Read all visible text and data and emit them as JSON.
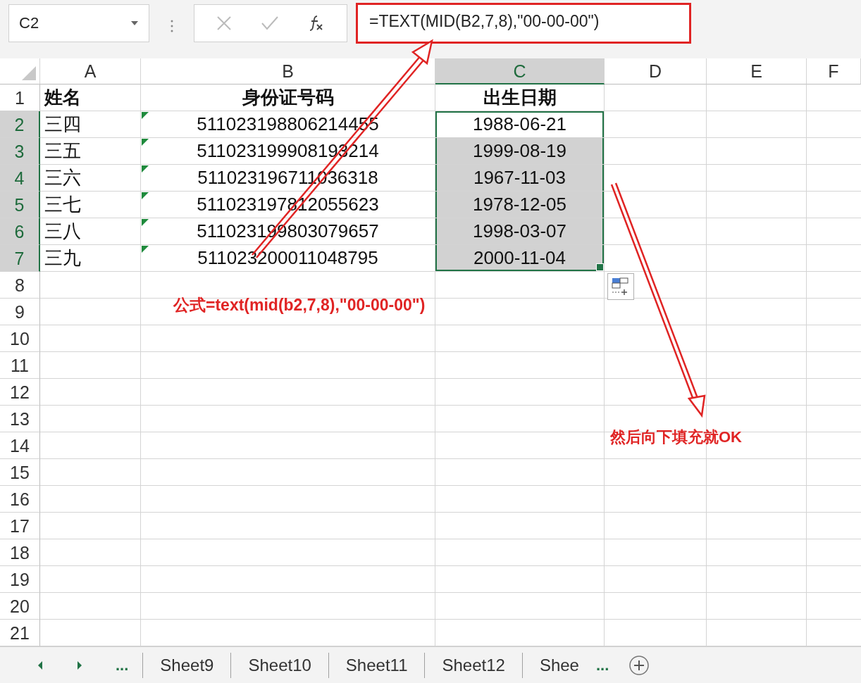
{
  "name_box": {
    "value": "C2"
  },
  "formula_bar": {
    "formula": "=TEXT(MID(B2,7,8),\"00-00-00\")",
    "highlighted": true
  },
  "columns": [
    {
      "label": "A",
      "selected": false
    },
    {
      "label": "B",
      "selected": false
    },
    {
      "label": "C",
      "selected": true
    },
    {
      "label": "D",
      "selected": false
    },
    {
      "label": "E",
      "selected": false
    },
    {
      "label": "F",
      "selected": false
    }
  ],
  "rows": [
    {
      "number": "1",
      "selected": false,
      "kind": "header",
      "a": "姓名",
      "b": "身份证号码",
      "c": "出生日期"
    },
    {
      "number": "2",
      "selected": true,
      "kind": "data",
      "a": "三四",
      "b": "511023198806214455",
      "c": "1988-06-21",
      "id_flag": true,
      "active": true,
      "in_selection": true
    },
    {
      "number": "3",
      "selected": true,
      "kind": "data",
      "a": "三五",
      "b": "511023199908193214",
      "c": "1999-08-19",
      "id_flag": true,
      "active": false,
      "in_selection": true
    },
    {
      "number": "4",
      "selected": true,
      "kind": "data",
      "a": "三六",
      "b": "511023196711036318",
      "c": "1967-11-03",
      "id_flag": true,
      "active": false,
      "in_selection": true
    },
    {
      "number": "5",
      "selected": true,
      "kind": "data",
      "a": "三七",
      "b": "511023197812055623",
      "c": "1978-12-05",
      "id_flag": true,
      "active": false,
      "in_selection": true
    },
    {
      "number": "6",
      "selected": true,
      "kind": "data",
      "a": "三八",
      "b": "511023199803079657",
      "c": "1998-03-07",
      "id_flag": true,
      "active": false,
      "in_selection": true
    },
    {
      "number": "7",
      "selected": true,
      "kind": "data",
      "a": "三九",
      "b": "511023200011048795",
      "c": "2000-11-04",
      "id_flag": true,
      "active": false,
      "in_selection": true
    },
    {
      "number": "8",
      "selected": false
    },
    {
      "number": "9",
      "selected": false
    },
    {
      "number": "10",
      "selected": false
    },
    {
      "number": "11",
      "selected": false
    },
    {
      "number": "12",
      "selected": false
    },
    {
      "number": "13",
      "selected": false
    },
    {
      "number": "14",
      "selected": false
    },
    {
      "number": "15",
      "selected": false
    },
    {
      "number": "16",
      "selected": false
    },
    {
      "number": "17",
      "selected": false
    },
    {
      "number": "18",
      "selected": false
    },
    {
      "number": "19",
      "selected": false
    },
    {
      "number": "20",
      "selected": false
    },
    {
      "number": "21",
      "selected": false
    }
  ],
  "annotations": [
    {
      "kind": "formula-note",
      "text": "公式=text(mid(b2,7,8),\"00-00-00\")"
    },
    {
      "kind": "fill-note",
      "text": "然后向下填充就OK"
    }
  ],
  "sheet_tabs": {
    "more_left": "...",
    "tabs": [
      {
        "label": "Sheet9",
        "selected": false
      },
      {
        "label": "Sheet10",
        "selected": false
      },
      {
        "label": "Sheet11",
        "selected": false
      },
      {
        "label": "Sheet12",
        "selected": false
      },
      {
        "label": "Shee",
        "selected": false
      }
    ],
    "more_right": "..."
  }
}
